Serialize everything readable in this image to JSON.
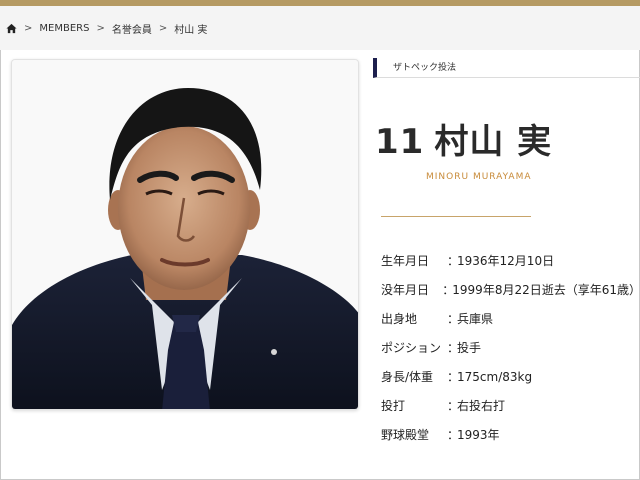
{
  "breadcrumb": {
    "home_icon": "home-icon",
    "items": [
      "MEMBERS",
      "名誉会員",
      "村山 実"
    ],
    "separator": ">"
  },
  "category": "ザトペック投法",
  "player": {
    "number": "11",
    "name": "村山 実",
    "romanized": "MINORU MURAYAMA"
  },
  "profile": [
    {
      "label": "生年月日",
      "value": "1936年12月10日"
    },
    {
      "label": "没年月日",
      "value": "1999年8月22日逝去（享年61歳）"
    },
    {
      "label": "出身地",
      "value": "兵庫県"
    },
    {
      "label": "ポジション",
      "value": "投手"
    },
    {
      "label": "身長/体重",
      "value": "175cm/83kg"
    },
    {
      "label": "投打",
      "value": "右投右打"
    },
    {
      "label": "野球殿堂",
      "value": "1993年"
    }
  ],
  "profile_separator": "：",
  "colors": {
    "accent_gold": "#b59a63",
    "romanized_orange": "#c88b3a",
    "category_bar_navy": "#1d1f4d"
  }
}
